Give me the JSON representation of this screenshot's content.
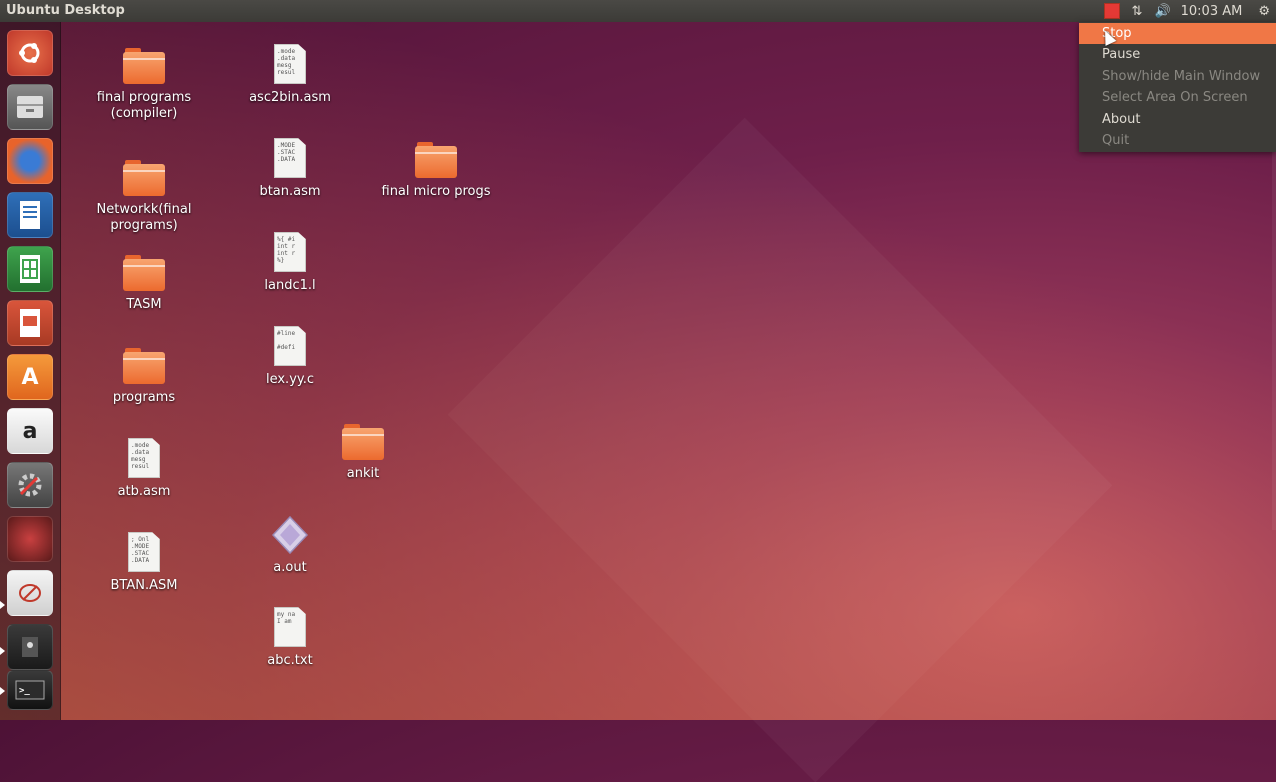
{
  "panel": {
    "title": "Ubuntu Desktop",
    "clock": "10:03 AM"
  },
  "menu": {
    "items": [
      {
        "label": "Stop",
        "state": "active"
      },
      {
        "label": "Pause",
        "state": "enabled"
      },
      {
        "label": "Show/hide Main Window",
        "state": "disabled"
      },
      {
        "label": "Select Area On Screen",
        "state": "disabled"
      },
      {
        "label": "About",
        "state": "enabled"
      },
      {
        "label": "Quit",
        "state": "disabled"
      }
    ]
  },
  "launcher": {
    "items": [
      {
        "icon": "ubuntu-dash-icon"
      },
      {
        "icon": "files-icon"
      },
      {
        "icon": "firefox-icon"
      },
      {
        "icon": "libreoffice-writer-icon"
      },
      {
        "icon": "libreoffice-calc-icon"
      },
      {
        "icon": "libreoffice-impress-icon"
      },
      {
        "icon": "software-center-icon",
        "glyph": "A"
      },
      {
        "icon": "amazon-icon",
        "glyph": "a"
      },
      {
        "icon": "system-settings-icon"
      },
      {
        "icon": "recorder-icon"
      },
      {
        "icon": "text-editor-icon"
      },
      {
        "icon": "screenshot-icon"
      },
      {
        "icon": "terminal-icon"
      }
    ]
  },
  "desktop": {
    "items": [
      {
        "label": "final programs (compiler)",
        "type": "folder"
      },
      {
        "label": "Networkk(final programs)",
        "type": "folder"
      },
      {
        "label": "TASM",
        "type": "folder"
      },
      {
        "label": "programs",
        "type": "folder"
      },
      {
        "label": "atb.asm",
        "type": "file",
        "preview": ".mode\n.data\nmesg\nresul"
      },
      {
        "label": "BTAN.ASM",
        "type": "file",
        "preview": "; Onl\n.MODE\n.STAC\n.DATA"
      },
      {
        "label": "asc2bin.asm",
        "type": "file",
        "preview": ".mode\n.data\nmesg\nresul"
      },
      {
        "label": "btan.asm",
        "type": "file",
        "preview": ".MODE\n.STAC\n.DATA"
      },
      {
        "label": "landc1.l",
        "type": "file",
        "preview": "%{ #i\nint r\nint r\n%}"
      },
      {
        "label": "lex.yy.c",
        "type": "file",
        "preview": "#line\n\n#defi"
      },
      {
        "label": "a.out",
        "type": "executable"
      },
      {
        "label": "abc.txt",
        "type": "file",
        "preview": "my na\nI am"
      },
      {
        "label": "final micro progs",
        "type": "folder"
      },
      {
        "label": "ankit",
        "type": "folder"
      }
    ]
  },
  "colors": {
    "menu_highlight": "#f07746",
    "panel_bg": "#3c3b37",
    "record_indicator": "#e53935"
  }
}
